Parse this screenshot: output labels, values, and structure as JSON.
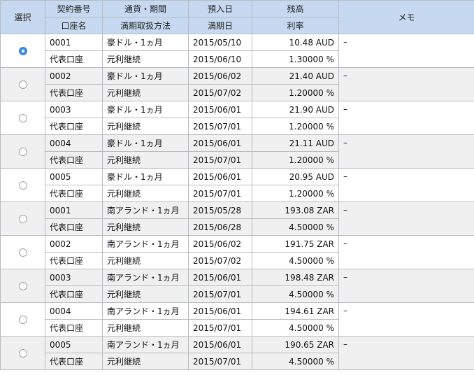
{
  "header": {
    "select": "選択",
    "contract_no": "契約番号",
    "currency_period": "通貨・期間",
    "deposit_date": "預入日",
    "balance": "残高",
    "memo": "メモ",
    "account_name": "口座名",
    "maturity_method": "満期取扱方法",
    "maturity_date": "満期日",
    "interest_rate": "利率"
  },
  "rows": [
    {
      "selected": true,
      "contract": "0001",
      "currency": "豪ドル・1ヵ月",
      "deposit": "2015/05/10",
      "balance": "10.48 AUD",
      "memo": "–",
      "account": "代表口座",
      "method": "元利継続",
      "maturity": "2015/06/10",
      "rate": "1.30000 %"
    },
    {
      "selected": false,
      "contract": "0002",
      "currency": "豪ドル・1ヵ月",
      "deposit": "2015/06/02",
      "balance": "21.40 AUD",
      "memo": "–",
      "account": "代表口座",
      "method": "元利継続",
      "maturity": "2015/07/02",
      "rate": "1.20000 %"
    },
    {
      "selected": false,
      "contract": "0003",
      "currency": "豪ドル・1ヵ月",
      "deposit": "2015/06/01",
      "balance": "21.90 AUD",
      "memo": "–",
      "account": "代表口座",
      "method": "元利継続",
      "maturity": "2015/07/01",
      "rate": "1.20000 %"
    },
    {
      "selected": false,
      "contract": "0004",
      "currency": "豪ドル・1ヵ月",
      "deposit": "2015/06/01",
      "balance": "21.11 AUD",
      "memo": "–",
      "account": "代表口座",
      "method": "元利継続",
      "maturity": "2015/07/01",
      "rate": "1.20000 %"
    },
    {
      "selected": false,
      "contract": "0005",
      "currency": "豪ドル・1ヵ月",
      "deposit": "2015/06/01",
      "balance": "20.95 AUD",
      "memo": "–",
      "account": "代表口座",
      "method": "元利継続",
      "maturity": "2015/07/01",
      "rate": "1.20000 %"
    },
    {
      "selected": false,
      "contract": "0001",
      "currency": "南アランド・1ヵ月",
      "deposit": "2015/05/28",
      "balance": "193.08 ZAR",
      "memo": "–",
      "account": "代表口座",
      "method": "元利継続",
      "maturity": "2015/06/28",
      "rate": "4.50000 %"
    },
    {
      "selected": false,
      "contract": "0002",
      "currency": "南アランド・1ヵ月",
      "deposit": "2015/06/02",
      "balance": "191.75 ZAR",
      "memo": "–",
      "account": "代表口座",
      "method": "元利継続",
      "maturity": "2015/07/02",
      "rate": "4.50000 %"
    },
    {
      "selected": false,
      "contract": "0003",
      "currency": "南アランド・1ヵ月",
      "deposit": "2015/06/01",
      "balance": "198.48 ZAR",
      "memo": "–",
      "account": "代表口座",
      "method": "元利継続",
      "maturity": "2015/07/01",
      "rate": "4.50000 %"
    },
    {
      "selected": false,
      "contract": "0004",
      "currency": "南アランド・1ヵ月",
      "deposit": "2015/06/01",
      "balance": "194.61 ZAR",
      "memo": "–",
      "account": "代表口座",
      "method": "元利継続",
      "maturity": "2015/07/01",
      "rate": "4.50000 %"
    },
    {
      "selected": false,
      "contract": "0005",
      "currency": "南アランド・1ヵ月",
      "deposit": "2015/06/01",
      "balance": "190.65 ZAR",
      "memo": "–",
      "account": "代表口座",
      "method": "元利継続",
      "maturity": "2015/07/01",
      "rate": "4.50000 %"
    }
  ]
}
